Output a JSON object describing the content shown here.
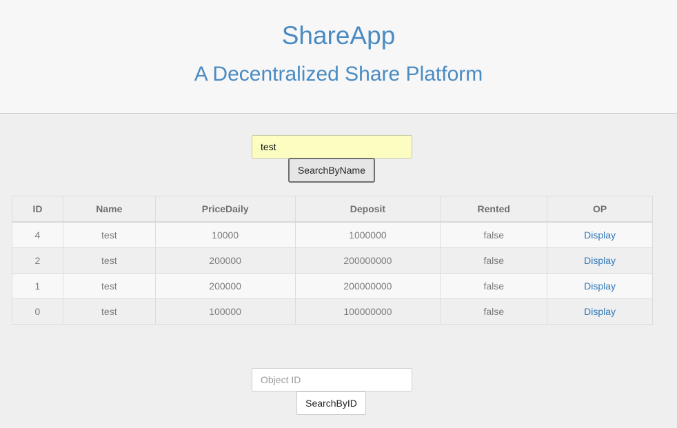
{
  "header": {
    "title": "ShareApp",
    "subtitle": "A Decentralized Share Platform"
  },
  "search_by_name": {
    "input_value": "test",
    "button_label": "SearchByName"
  },
  "table": {
    "columns": [
      "ID",
      "Name",
      "PriceDaily",
      "Deposit",
      "Rented",
      "OP"
    ],
    "rows": [
      {
        "id": "4",
        "name": "test",
        "price_daily": "10000",
        "deposit": "1000000",
        "rented": "false",
        "op": "Display"
      },
      {
        "id": "2",
        "name": "test",
        "price_daily": "200000",
        "deposit": "200000000",
        "rented": "false",
        "op": "Display"
      },
      {
        "id": "1",
        "name": "test",
        "price_daily": "200000",
        "deposit": "200000000",
        "rented": "false",
        "op": "Display"
      },
      {
        "id": "0",
        "name": "test",
        "price_daily": "100000",
        "deposit": "100000000",
        "rented": "false",
        "op": "Display"
      }
    ]
  },
  "search_by_id": {
    "placeholder": "Object ID",
    "button_label": "SearchByID"
  },
  "colors": {
    "brand": "#4a8bc2",
    "link": "#2f78b9",
    "highlight_input": "#fbfec0"
  }
}
